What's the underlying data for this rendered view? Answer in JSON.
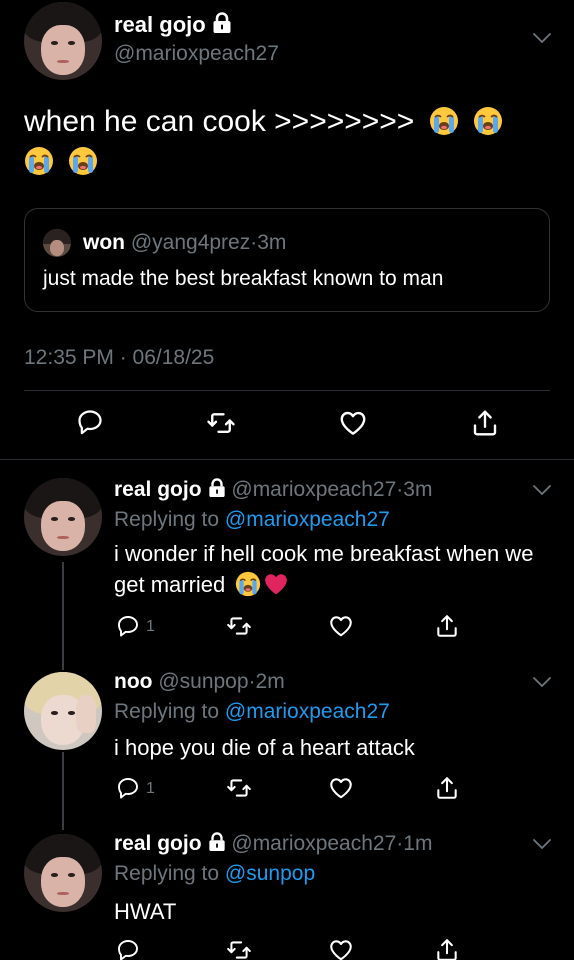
{
  "main": {
    "display_name": "real gojo",
    "handle": "@marioxpeach27",
    "text": "when he can cook >>>>>>>>",
    "emoji_count_line1": 2,
    "emoji_count_line2": 2,
    "quote": {
      "display_name": "won",
      "handle": "@yang4prez",
      "sep": "·",
      "time": "3m",
      "text": "just made the best breakfast known to man"
    },
    "timestamp": "12:35 PM · 06/18/25"
  },
  "replies": [
    {
      "display_name": "real gojo",
      "handle": "@marioxpeach27",
      "sep": "·",
      "time": "3m",
      "replying_prefix": "Replying to",
      "replying_to": "@marioxpeach27",
      "text": "i wonder if hell cook me breakfast when we get married",
      "reply_count": "1"
    },
    {
      "display_name": "noo",
      "handle": "@sunpop",
      "sep": "·",
      "time": "2m",
      "replying_prefix": "Replying to",
      "replying_to": "@marioxpeach27",
      "text": "i hope you die of a heart attack",
      "reply_count": "1"
    },
    {
      "display_name": "real gojo",
      "handle": "@marioxpeach27",
      "sep": "·",
      "time": "1m",
      "replying_prefix": "Replying to",
      "replying_to": "@sunpop",
      "text": "HWAT"
    }
  ],
  "colors": {
    "background": "#000000",
    "muted": "#6e767d",
    "link": "#1d9bf0",
    "heart": "#e0245e"
  },
  "icons": [
    "lock-icon",
    "chevron-down-icon",
    "reply-icon",
    "retweet-icon",
    "like-icon",
    "share-icon",
    "loudly-crying-emoji",
    "red-heart-emoji"
  ]
}
